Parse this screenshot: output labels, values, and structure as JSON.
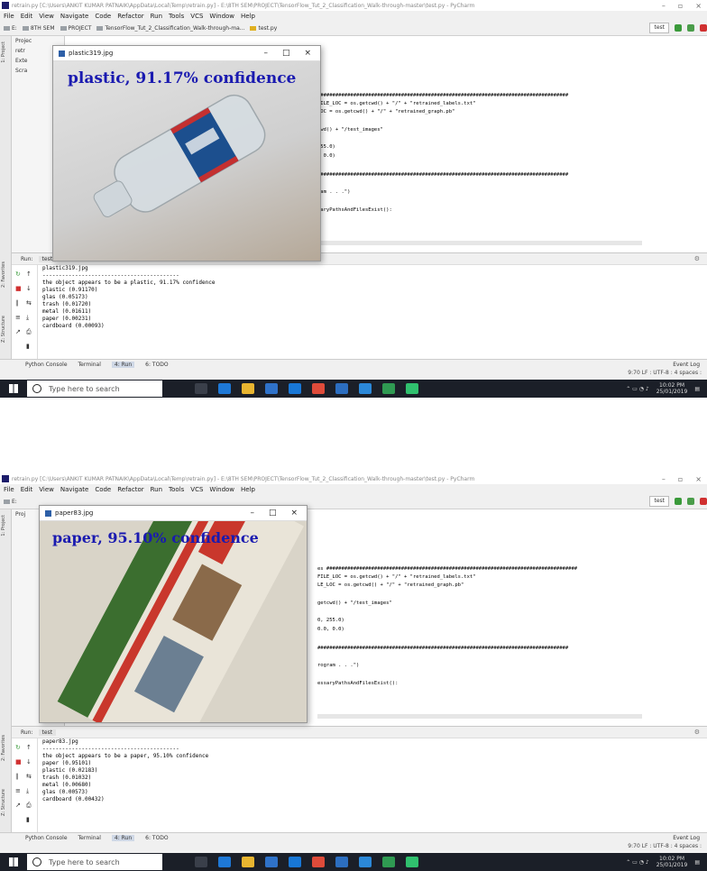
{
  "colors": {
    "overlay_text": "#1a1ab0",
    "taskbar": "#1b1f28",
    "run_active": "#cfd8e6"
  },
  "screens": [
    {
      "title": "retrain.py [C:\\Users\\ANKIT KUMAR PATNAIK\\AppData\\Local\\Temp\\retrain.py] - E:\\8TH SEM\\PROJECT\\TensorFlow_Tut_2_Classification_Walk-through-master\\test.py - PyCharm",
      "menu": [
        "File",
        "Edit",
        "View",
        "Navigate",
        "Code",
        "Refactor",
        "Run",
        "Tools",
        "VCS",
        "Window",
        "Help"
      ],
      "breadcrumb": [
        "E:",
        "8TH SEM",
        "PROJECT",
        "TensorFlow_Tut_2_Classification_Walk-through-ma...",
        "test.py"
      ],
      "run_config": "test",
      "project_items": [
        "Projec",
        "retr",
        "Exte",
        "Scra"
      ],
      "code": [
        "####################################################################################",
        "FILE_LOC = os.getcwd() + \"/\" + \"retrained_labels.txt\"",
        "LOC = os.getcwd() + \"/\" + \"retrained_graph.pb\"",
        "twd() + \"/test_images\"",
        "255.0)",
        ", 0.0)",
        "####################################################################################",
        "ram . . .\")",
        "saryPathsAndFilesExist():"
      ],
      "run_label": "Run:",
      "run_tab": "test",
      "console": [
        "plastic319.jpg",
        "------------------------------------------",
        "the object appears to be a plastic, 91.17% confidence",
        "plastic (0.91170)",
        "glas (0.05173)",
        "trash (0.01720)",
        "metal (0.01611)",
        "paper (0.00231)",
        "cardboard (0.00093)"
      ],
      "bottom_tabs": [
        "Python Console",
        "Terminal",
        "4: Run",
        "6: TODO"
      ],
      "event_log": "Event Log",
      "status": "9:70  LF :  UTF-8 :  4 spaces :",
      "search_placeholder": "Type here to search",
      "clock_time": "10:02 PM",
      "clock_date": "25/01/2019",
      "popup_title": "plastic319.jpg",
      "overlay": "plastic, 91.17% confidence"
    },
    {
      "title": "retrain.py [C:\\Users\\ANKIT KUMAR PATNAIK\\AppData\\Local\\Temp\\retrain.py] - E:\\8TH SEM\\PROJECT\\TensorFlow_Tut_2_Classification_Walk-through-master\\test.py - PyCharm",
      "menu": [
        "File",
        "Edit",
        "View",
        "Navigate",
        "Code",
        "Refactor",
        "Run",
        "Tools",
        "VCS",
        "Window",
        "Help"
      ],
      "breadcrumb": [
        "E:",
        "8TH SEM",
        "PROJECT",
        "TensorFlow_Tut_2_Classification_Walk-through-ma...",
        "test.py"
      ],
      "run_config": "test",
      "project_items": [
        "Proj",
        "",
        "",
        ""
      ],
      "code": [
        "es ####################################################################################",
        "FILE_LOC = os.getcwd() + \"/\" + \"retrained_labels.txt\"",
        "LE_LOC = os.getcwd() + \"/\" + \"retrained_graph.pb\"",
        "getcwd() + \"/test_images\"",
        "0, 255.0)",
        "0.0, 0.0)",
        "####################################################################################",
        "rogram . . .\")",
        "essaryPathsAndFilesExist():"
      ],
      "run_label": "Run:",
      "run_tab": "test",
      "console": [
        "paper83.jpg",
        "------------------------------------------",
        "the object appears to be a paper, 95.10% confidence",
        "paper (0.95101)",
        "plastic (0.02183)",
        "trash (0.01032)",
        "metal (0.00680)",
        "glas (0.00573)",
        "cardboard (0.00432)"
      ],
      "bottom_tabs": [
        "Python Console",
        "Terminal",
        "4: Run",
        "6: TODO"
      ],
      "event_log": "Event Log",
      "status": "9:70  LF :  UTF-8 :  4 spaces :",
      "search_placeholder": "Type here to search",
      "clock_time": "10:02 PM",
      "clock_date": "25/01/2019",
      "popup_title": "paper83.jpg",
      "overlay": "paper, 95.10% confidence"
    }
  ]
}
